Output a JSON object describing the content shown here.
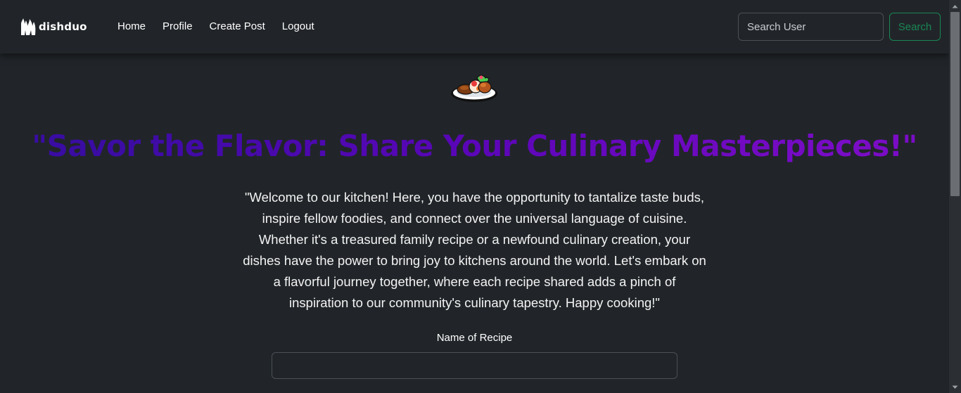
{
  "navbar": {
    "brand": "dishduo",
    "links": [
      "Home",
      "Profile",
      "Create Post",
      "Logout"
    ],
    "search": {
      "placeholder": "Search User",
      "button_label": "Search"
    },
    "colors": {
      "search_button": "#198754"
    }
  },
  "main": {
    "hero_icon": "plate-of-food-icon",
    "headline": "\"Savor the Flavor: Share Your Culinary Masterpieces!\"",
    "welcome_text": "\"Welcome to our kitchen! Here, you have the opportunity to tantalize taste buds, inspire fellow foodies, and connect over the universal language of cuisine. Whether it's a treasured family recipe or a newfound culinary creation, your dishes have the power to bring joy to kitchens around the world. Let's embark on a flavorful journey together, where each recipe shared adds a pinch of inspiration to our community's culinary tapestry. Happy cooking!\"",
    "form": {
      "recipe_name_label": "Name of Recipe",
      "recipe_name_value": ""
    },
    "colors": {
      "headline_gradient_start": "#3a0ca3",
      "headline_gradient_end": "#7a0cc6",
      "background": "#212529"
    }
  }
}
